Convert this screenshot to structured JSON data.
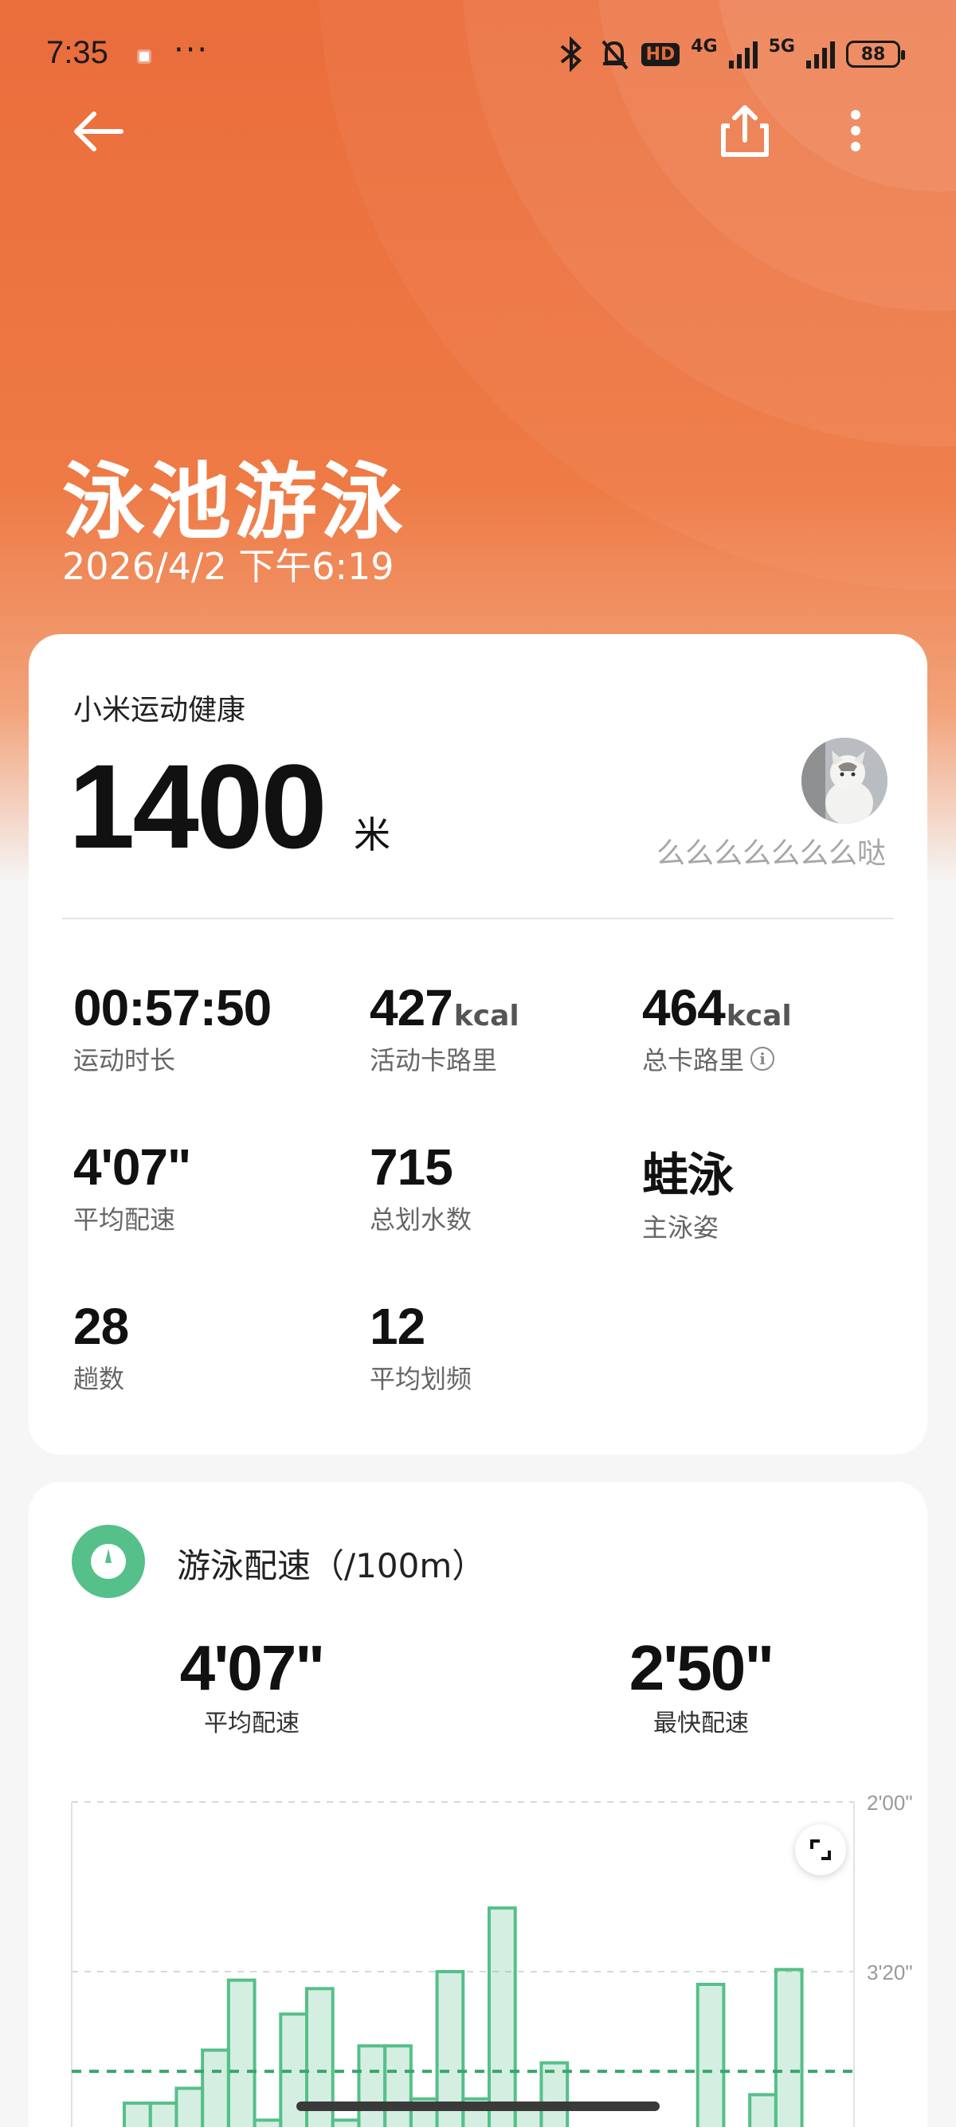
{
  "status_bar": {
    "time": "7:35",
    "more": "···",
    "hd_label": "HD",
    "network_1": "4G",
    "network_2": "5G",
    "battery": "88"
  },
  "header": {
    "title": "泳池游泳",
    "date": "2026/4/2 下午6:19"
  },
  "summary": {
    "source": "小米运动健康",
    "distance": "1400",
    "distance_unit": "米",
    "username": "么么么么么么么哒",
    "stats": [
      {
        "value": "00:57:50",
        "unit": "",
        "label": "运动时长"
      },
      {
        "value": "427",
        "unit": "kcal",
        "label": "活动卡路里"
      },
      {
        "value": "464",
        "unit": "kcal",
        "label": "总卡路里"
      },
      {
        "value": "4'07\"",
        "unit": "",
        "label": "平均配速"
      },
      {
        "value": "715",
        "unit": "",
        "label": "总划水数"
      },
      {
        "value": "蛙泳",
        "unit": "",
        "label": "主泳姿"
      },
      {
        "value": "28",
        "unit": "",
        "label": "趟数"
      },
      {
        "value": "12",
        "unit": "",
        "label": "平均划频"
      }
    ]
  },
  "pace": {
    "title": "游泳配速（/100m）",
    "avg_value": "4'07\"",
    "avg_label": "平均配速",
    "max_value": "2'50\"",
    "max_label": "最快配速"
  },
  "colors": {
    "accent_orange": "#ec7240",
    "chart_green": "#55c089"
  },
  "chart_data": {
    "type": "bar",
    "ytick_labels": [
      "2'00\"",
      "3'20\""
    ],
    "y_axis_inverted": true,
    "average_line": "4'07\"",
    "visible_bar_tops_in_seconds": [
      262,
      262,
      255,
      237,
      204,
      270,
      220,
      208,
      270,
      235,
      235,
      260,
      200,
      260,
      170,
      262,
      243,
      276,
      276,
      300,
      300,
      300,
      206,
      300,
      258,
      199,
      300,
      275
    ]
  }
}
